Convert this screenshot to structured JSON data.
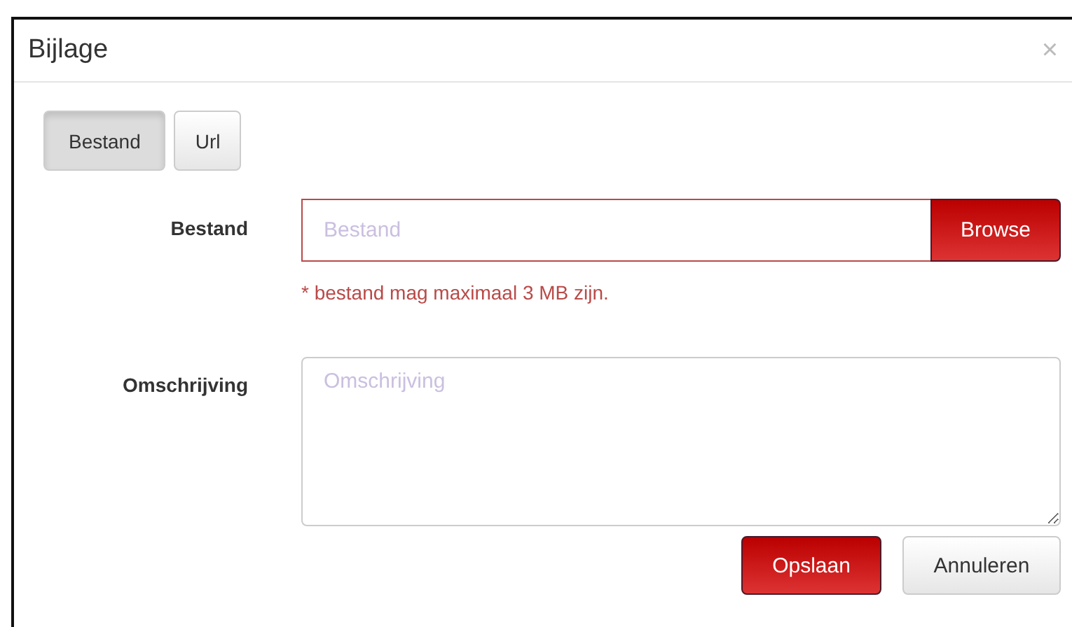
{
  "dialog": {
    "title": "Bijlage",
    "close": "×"
  },
  "tabs": [
    {
      "label": "Bestand",
      "selected": true
    },
    {
      "label": "Url",
      "selected": false
    }
  ],
  "fields": [
    {
      "kind": "file",
      "label": "Bestand",
      "placeholder": "Bestand",
      "button": "Browse",
      "help": "* bestand mag maximaal 3 MB zijn."
    },
    {
      "kind": "textarea",
      "label": "Omschrijving",
      "placeholder": "Omschrijving"
    }
  ],
  "buttons": [
    {
      "label": "Opslaan",
      "kind": "primary"
    },
    {
      "label": "Annuleren",
      "kind": "default"
    }
  ]
}
